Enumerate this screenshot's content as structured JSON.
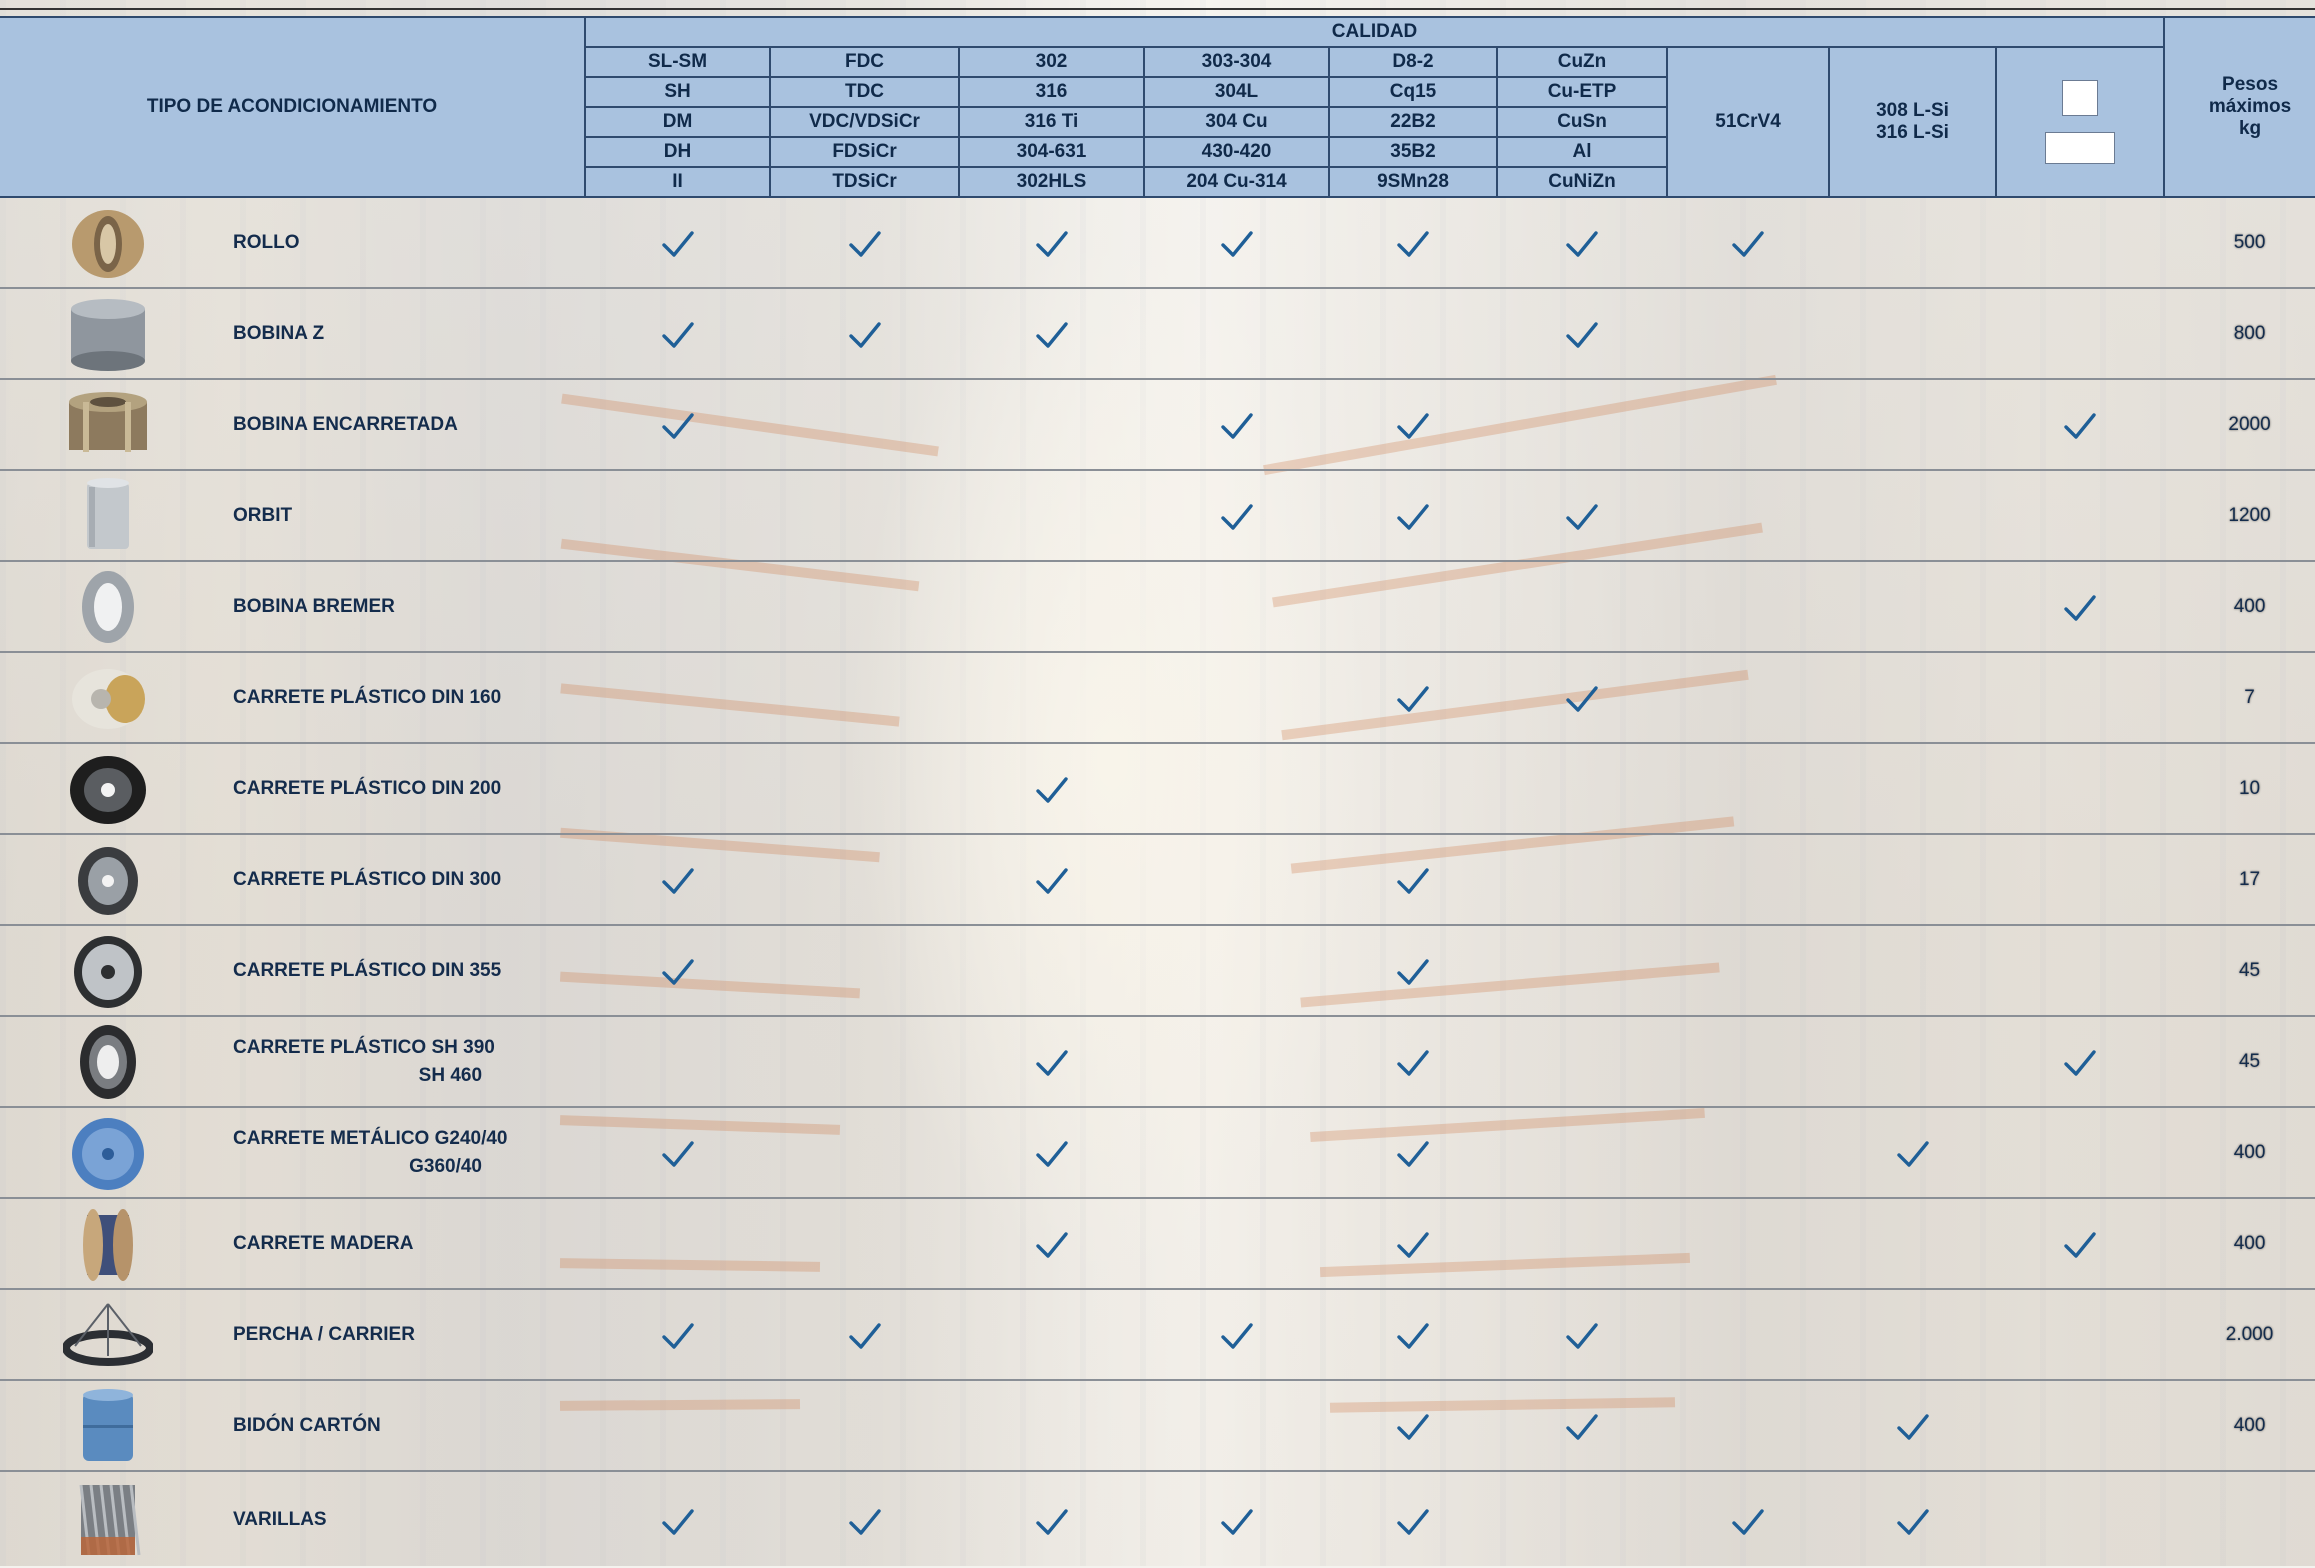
{
  "header": {
    "tipo_label": "TIPO DE ACONDICIONAMIENTO",
    "calidad_label": "CALIDAD",
    "peso_label_line1": "Pesos",
    "peso_label_line2": "máximos",
    "peso_label_line3": "kg",
    "quality_rows": [
      [
        "SL-SM",
        "FDC",
        "302",
        "303-304",
        "D8-2",
        "CuZn"
      ],
      [
        "SH",
        "TDC",
        "316",
        "304L",
        "Cq15",
        "Cu-ETP"
      ],
      [
        "DM",
        "VDC/VDSiCr",
        "316 Ti",
        "304 Cu",
        "22B2",
        "CuSn"
      ],
      [
        "DH",
        "FDSiCr",
        "304-631",
        "430-420",
        "35B2",
        "Al"
      ],
      [
        "II",
        "TDSiCr",
        "302HLS",
        "204 Cu-314",
        "9SMn28",
        "CuNiZn"
      ]
    ],
    "col7_label": "51CrV4",
    "col8_line1": "308 L-Si",
    "col8_line2": "316 L-Si"
  },
  "check_color": "#1f5f97",
  "rows": [
    {
      "icon": "wire-roll-icon",
      "name": "ROLLO",
      "name2": "",
      "peso": "500",
      "checks": [
        1,
        1,
        1,
        1,
        1,
        1,
        1,
        0,
        0
      ]
    },
    {
      "icon": "coil-z-icon",
      "name": "BOBINA Z",
      "name2": "",
      "peso": "800",
      "checks": [
        1,
        1,
        1,
        0,
        0,
        1,
        0,
        0,
        0
      ]
    },
    {
      "icon": "caged-coil-icon",
      "name": "BOBINA ENCARRETADA",
      "name2": "",
      "peso": "2000",
      "checks": [
        1,
        0,
        0,
        1,
        1,
        0,
        0,
        0,
        1
      ]
    },
    {
      "icon": "orbit-coil-icon",
      "name": "ORBIT",
      "name2": "",
      "peso": "1200",
      "checks": [
        0,
        0,
        0,
        1,
        1,
        1,
        0,
        0,
        0
      ]
    },
    {
      "icon": "bremer-coil-icon",
      "name": "BOBINA BREMER",
      "name2": "",
      "peso": "400",
      "checks": [
        0,
        0,
        0,
        0,
        0,
        0,
        0,
        0,
        1
      ]
    },
    {
      "icon": "plastic-spool-160-icon",
      "name": "CARRETE PLÁSTICO DIN 160",
      "name2": "",
      "peso": "7",
      "checks": [
        0,
        0,
        0,
        0,
        1,
        1,
        0,
        0,
        0
      ]
    },
    {
      "icon": "plastic-spool-200-icon",
      "name": "CARRETE PLÁSTICO DIN 200",
      "name2": "",
      "peso": "10",
      "checks": [
        0,
        0,
        1,
        0,
        0,
        0,
        0,
        0,
        0
      ]
    },
    {
      "icon": "plastic-spool-300-icon",
      "name": "CARRETE PLÁSTICO DIN 300",
      "name2": "",
      "peso": "17",
      "checks": [
        1,
        0,
        1,
        0,
        1,
        0,
        0,
        0,
        0
      ]
    },
    {
      "icon": "plastic-spool-355-icon",
      "name": "CARRETE PLÁSTICO DIN 355",
      "name2": "",
      "peso": "45",
      "checks": [
        1,
        0,
        0,
        0,
        1,
        0,
        0,
        0,
        0
      ]
    },
    {
      "icon": "plastic-spool-sh-icon",
      "name": "CARRETE PLÁSTICO SH 390",
      "name2": "SH 460",
      "peso": "45",
      "checks": [
        0,
        0,
        1,
        0,
        1,
        0,
        0,
        0,
        1
      ]
    },
    {
      "icon": "metal-spool-icon",
      "name": "CARRETE METÁLICO G240/40",
      "name2": "G360/40",
      "peso": "400",
      "checks": [
        1,
        0,
        1,
        0,
        1,
        0,
        0,
        1,
        0
      ]
    },
    {
      "icon": "wooden-spool-icon",
      "name": "CARRETE MADERA",
      "name2": "",
      "peso": "400",
      "checks": [
        0,
        0,
        1,
        0,
        1,
        0,
        0,
        0,
        1
      ]
    },
    {
      "icon": "carrier-hanger-icon",
      "name": "PERCHA / CARRIER",
      "name2": "",
      "peso": "2.000",
      "checks": [
        1,
        1,
        0,
        1,
        1,
        1,
        0,
        0,
        0
      ]
    },
    {
      "icon": "cardboard-drum-icon",
      "name": "BIDÓN CARTÓN",
      "name2": "",
      "peso": "400",
      "checks": [
        0,
        0,
        0,
        0,
        1,
        1,
        0,
        1,
        0
      ]
    },
    {
      "icon": "rods-bundle-icon",
      "name": "VARILLAS",
      "name2": "",
      "peso": "",
      "checks": [
        1,
        1,
        1,
        1,
        1,
        0,
        1,
        1,
        0
      ]
    }
  ]
}
